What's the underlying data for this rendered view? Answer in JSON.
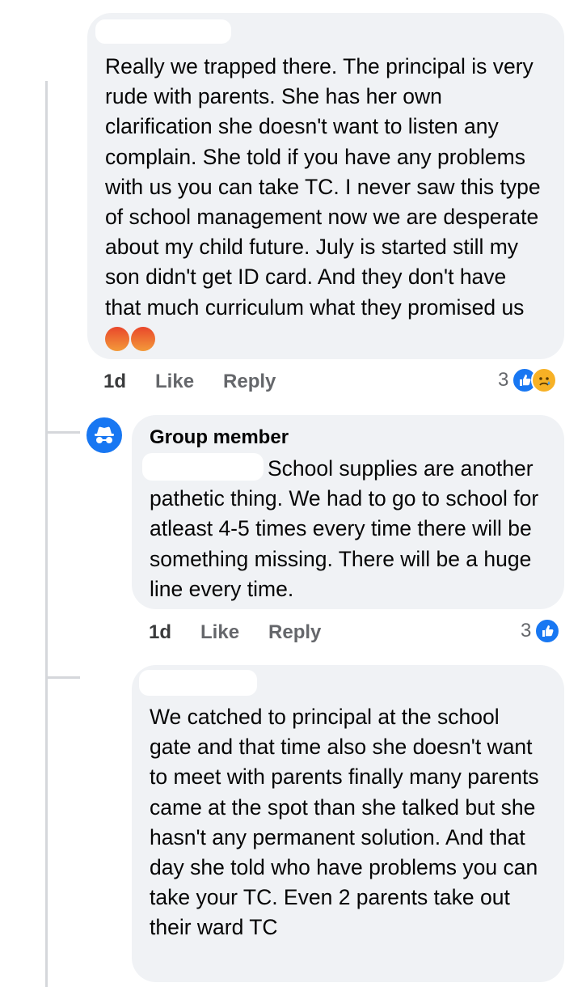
{
  "comments": [
    {
      "text": "Really we trapped there. The principal is very rude with parents. She has her own clarification she doesn't want to listen any complain. She told if you have any problems with us you can take TC. I never saw this type of school management now we are desperate about my child future. July is started still my son didn't get ID card. And they don't have that much curriculum what they promised us",
      "time": "1d",
      "like_label": "Like",
      "reply_label": "Reply",
      "reaction_count": "3",
      "reactions": [
        "like-icon",
        "sad-icon"
      ],
      "trailing_emoji": [
        "angry-face-icon",
        "angry-face-icon"
      ]
    },
    {
      "author": "Group member",
      "text": "School supplies are another pathetic thing. We had to go to school for atleast 4-5 times every time there will be something missing. There will be a huge line every time.",
      "time": "1d",
      "like_label": "Like",
      "reply_label": "Reply",
      "reaction_count": "3",
      "reactions": [
        "like-icon"
      ]
    },
    {
      "text": "We catched to principal at the school gate and that time also she doesn't want to meet with parents finally many parents came at the spot than she talked but she hasn't any permanent solution. And that day she told who have problems you can take your TC. Even 2 parents take out their ward TC"
    }
  ],
  "colors": {
    "bubble": "#f0f2f5",
    "action_text": "#65676b",
    "like_blue": "#1877f2",
    "thread_line": "#d5d7db"
  }
}
